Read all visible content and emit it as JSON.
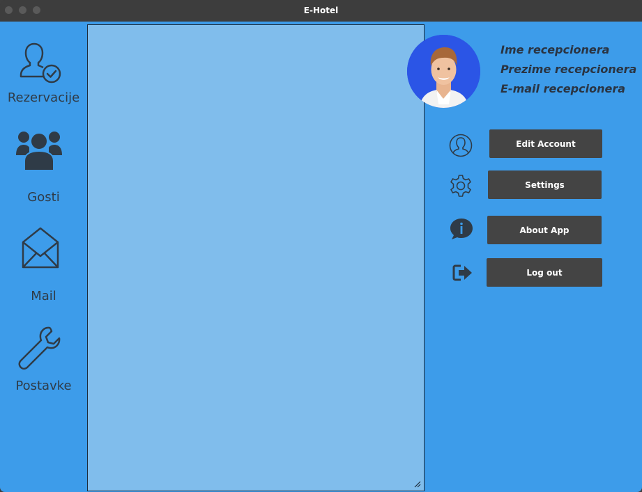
{
  "window": {
    "title": "E-Hotel"
  },
  "nav": {
    "items": [
      {
        "label": "Rezervacije",
        "icon": "user-check-icon"
      },
      {
        "label": "Gosti",
        "icon": "group-icon"
      },
      {
        "label": "Mail",
        "icon": "envelope-open-icon"
      },
      {
        "label": "Postavke",
        "icon": "wrench-icon"
      }
    ]
  },
  "profile": {
    "first_name": "Ime recepcionera",
    "last_name": "Prezime recepcionera",
    "email": "E-mail recepcionera"
  },
  "actions": {
    "edit_account": "Edit Account",
    "settings": "Settings",
    "about_app": "About App",
    "log_out": "Log out"
  },
  "colors": {
    "background": "#3d9cea",
    "panel": "#80bdec",
    "button": "#444444",
    "icon": "#2f3b47",
    "titlebar": "#3d3d3d"
  }
}
